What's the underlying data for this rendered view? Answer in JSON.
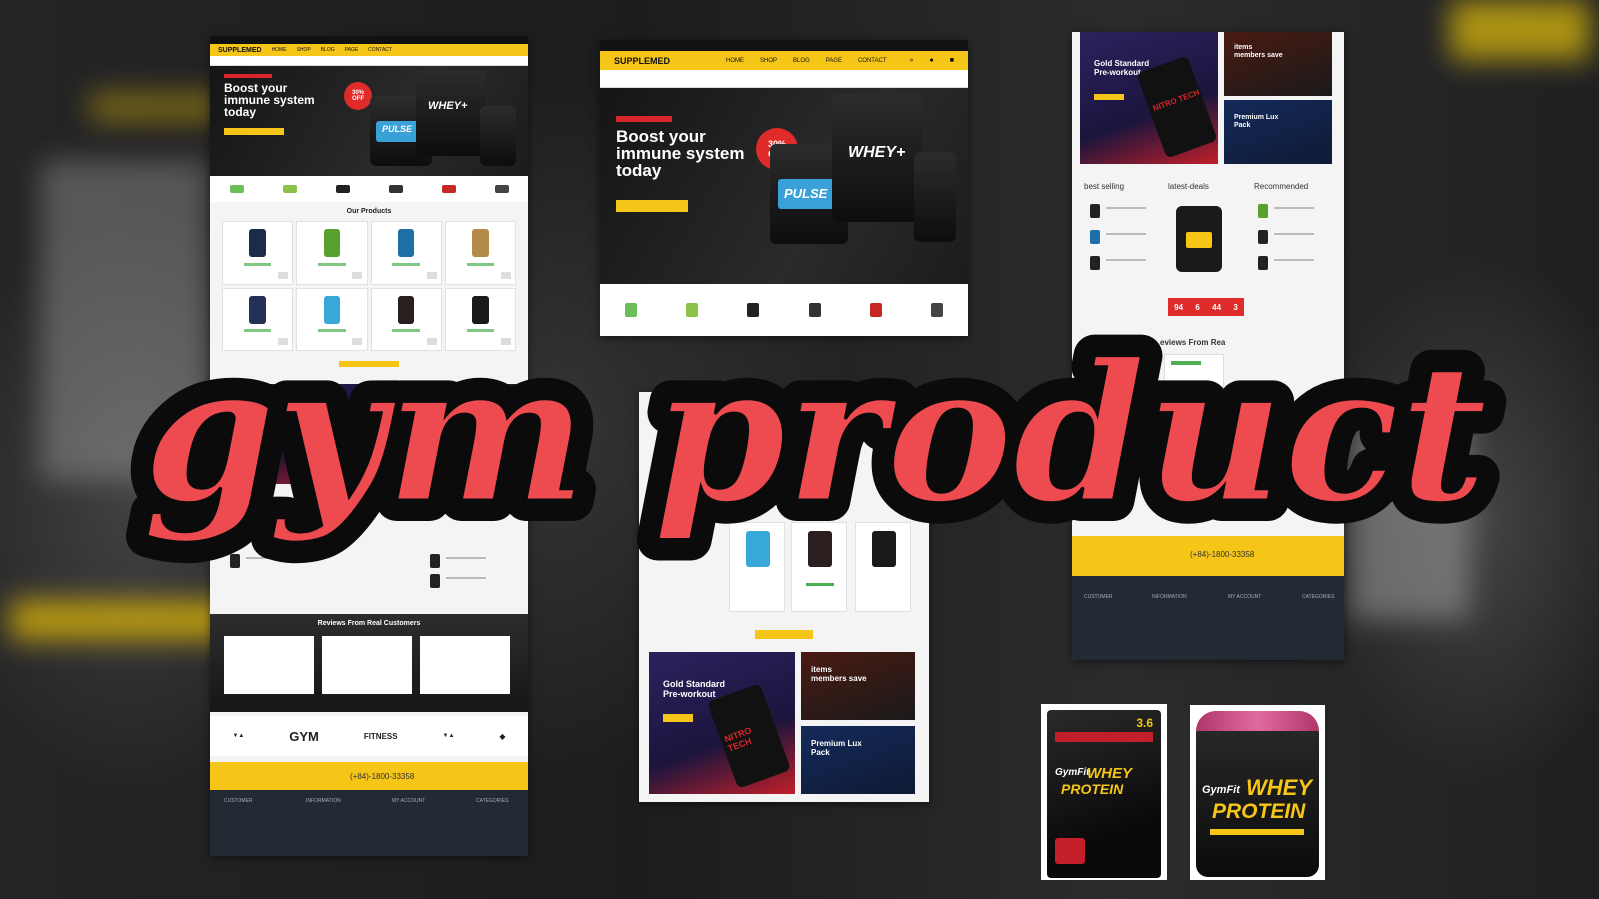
{
  "overlay": {
    "title": "gym product",
    "fill_color": "#ee4b50",
    "outline_color": "#0b0b0b"
  },
  "site": {
    "logo": "SUPPLEMED",
    "nav": [
      "HOME",
      "SHOP",
      "BLOG",
      "PAGE",
      "CONTACT"
    ],
    "accent_color": "#f5c518",
    "dark_color": "#111111",
    "sale_color": "#e02b2b"
  },
  "hero": {
    "title_line1": "Boost your",
    "title_line2": "immune system",
    "title_line3": "today",
    "badge_line1": "30%",
    "badge_line2": "OFF",
    "jar1_label": "PULSE",
    "jar2_label": "WHEY+"
  },
  "sections": {
    "our_products": "Our Products",
    "best_selling": "best selling",
    "latest_deals": "latest-deals",
    "recommended": "Recommended",
    "reviews": "Reviews From Real Customers",
    "reviews_partial": "eviews From Rea"
  },
  "promos": {
    "gold_standard": "Gold Standard",
    "pre_workout": "Pre-workout",
    "items": "items",
    "members_save": "members save",
    "premium_lux": "Premium Lux",
    "pack": "Pack",
    "nitro_tech": "NITRO TECH"
  },
  "countdown": [
    "94",
    "6",
    "44",
    "3"
  ],
  "brand_logos": [
    "GYM",
    "FITNESS"
  ],
  "footer": {
    "phone": "(+84)-1800-33358",
    "columns": [
      "CUSTOMER",
      "INFORMATION",
      "MY ACCOUNT",
      "CATEGORIES"
    ]
  },
  "product_photos": {
    "bag": {
      "brand": "GymFit",
      "line1": "WHEY",
      "line2": "PROTEIN",
      "size": "3.6"
    },
    "tub": {
      "brand": "GymFit",
      "line1": "WHEY",
      "line2": "PROTEIN"
    }
  }
}
